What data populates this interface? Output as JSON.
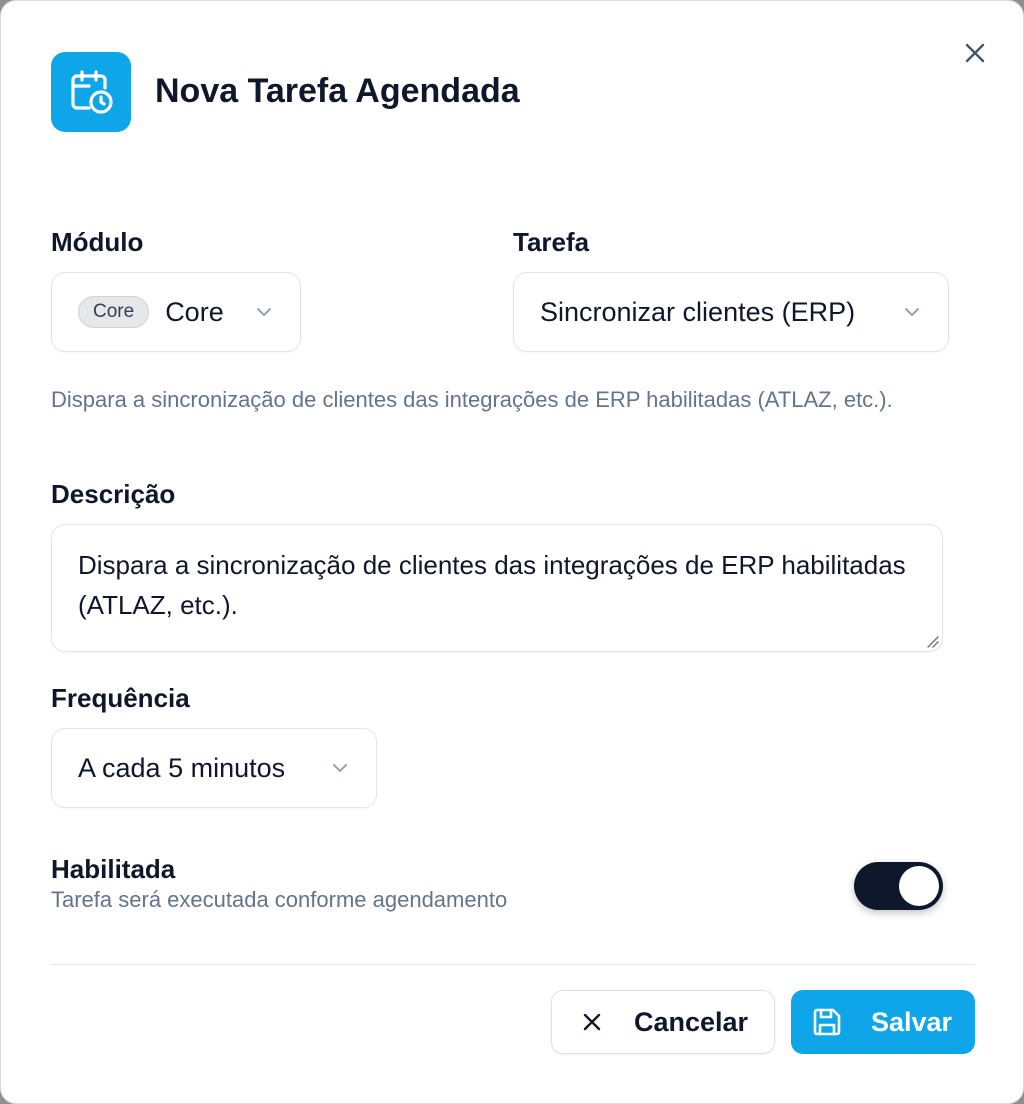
{
  "dialog": {
    "title": "Nova Tarefa Agendada",
    "header_icon": "calendar-clock-icon",
    "close_icon": "close-icon"
  },
  "form": {
    "module": {
      "label": "Módulo",
      "badge": "Core",
      "value": "Core"
    },
    "task": {
      "label": "Tarefa",
      "value": "Sincronizar clientes (ERP)"
    },
    "task_help": "Dispara a sincronização de clientes das integrações de ERP habilitadas (ATLAZ, etc.).",
    "description": {
      "label": "Descrição",
      "value": "Dispara a sincronização de clientes das integrações de ERP habilitadas (ATLAZ, etc.)."
    },
    "frequency": {
      "label": "Frequência",
      "value": "A cada 5 minutos"
    },
    "enabled": {
      "label": "Habilitada",
      "description": "Tarefa será executada conforme agendamento",
      "checked": true
    }
  },
  "footer": {
    "cancel_label": "Cancelar",
    "save_label": "Salvar"
  },
  "colors": {
    "accent": "#0ea5e9",
    "switch_on": "#0f172a",
    "muted_text": "#64748b"
  }
}
